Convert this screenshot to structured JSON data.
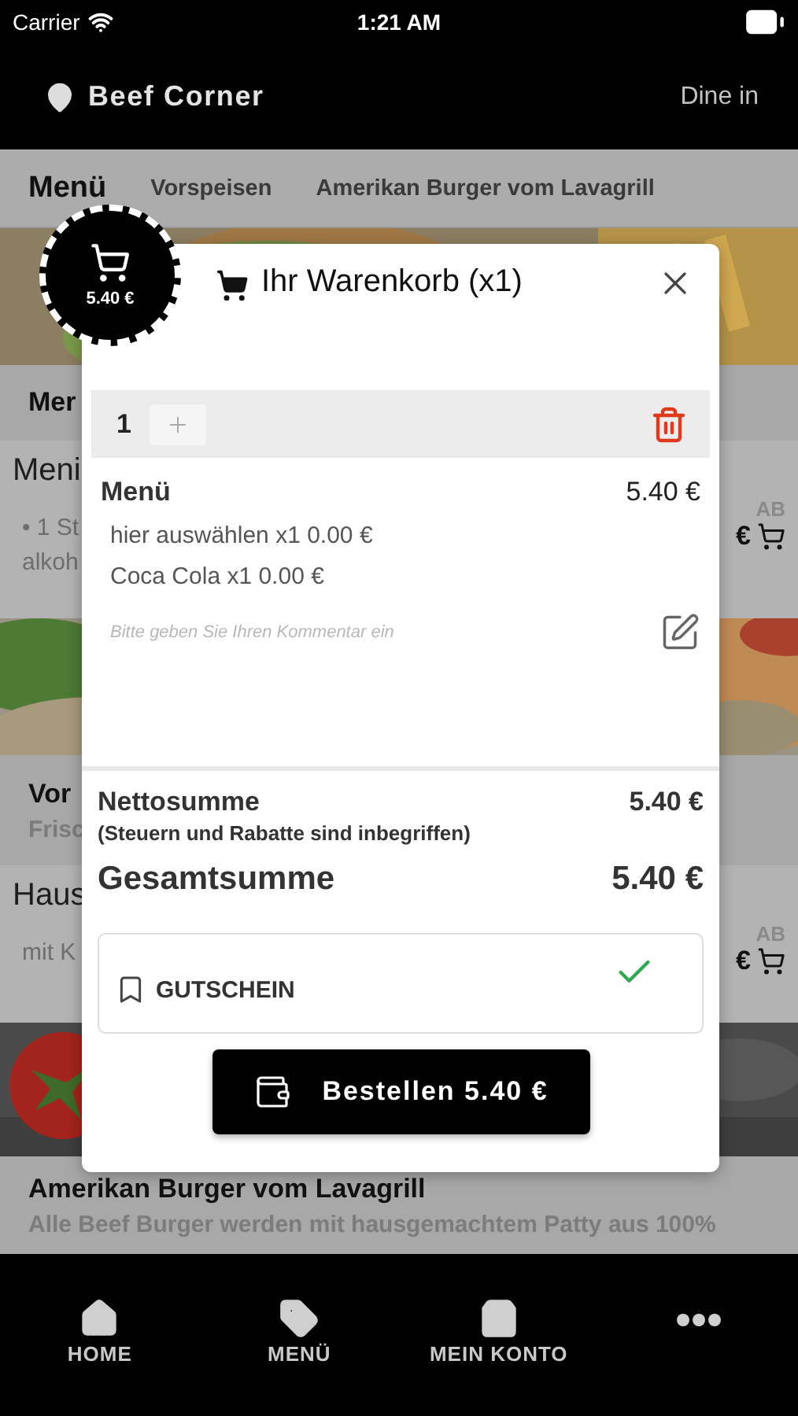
{
  "status_bar": {
    "carrier": "Carrier",
    "time": "1:21 AM"
  },
  "header": {
    "location": "Beef Corner",
    "mode": "Dine in"
  },
  "categories": [
    {
      "label": "Menü",
      "selected": true
    },
    {
      "label": "Vorspeisen",
      "selected": false
    },
    {
      "label": "Amerikan Burger vom Lavagrill",
      "selected": false
    }
  ],
  "cart_badge": {
    "total": "5.40 €"
  },
  "menu_list": [
    {
      "kind": "picture"
    },
    {
      "kind": "section",
      "title": "Mer"
    },
    {
      "kind": "item",
      "title": "Meni",
      "lines": [
        "• 1 St",
        "alkoh"
      ],
      "price_label": "AB",
      "price": "€"
    },
    {
      "kind": "picture"
    },
    {
      "kind": "section",
      "title": "Vor",
      "subtitle": "Frisc"
    },
    {
      "kind": "item",
      "title": "Haus",
      "lines": [
        "mit K"
      ],
      "price_label": "AB",
      "price": "€"
    },
    {
      "kind": "picture"
    },
    {
      "kind": "section",
      "title": "Amerikan Burger vom Lavagrill",
      "subtitle": "Alle Beef Burger werden mit hausgemachtem Patty aus 100%"
    }
  ],
  "cart": {
    "title": "Ihr Warenkorb (x1)",
    "quantity": "1",
    "item": {
      "name": "Menü",
      "price": "5.40 €",
      "options": [
        "hier auswählen x1 0.00 €",
        "Coca Cola x1 0.00 €"
      ],
      "comment_placeholder": "Bitte geben Sie Ihren Kommentar ein"
    },
    "net_label": "Nettosumme",
    "net_note": "(Steuern und Rabatte sind inbegriffen)",
    "net_value": "5.40 €",
    "total_label": "Gesamtsumme",
    "total_value": "5.40 €",
    "voucher": {
      "label": "GUTSCHEIN",
      "applied": true
    },
    "order_button": "Bestellen 5.40 €"
  },
  "tab_bar": [
    {
      "kind": "home",
      "label": "HOME"
    },
    {
      "kind": "tag",
      "label": "MENÜ"
    },
    {
      "kind": "bag",
      "label": "MEIN KONTO"
    },
    {
      "kind": "more"
    }
  ]
}
